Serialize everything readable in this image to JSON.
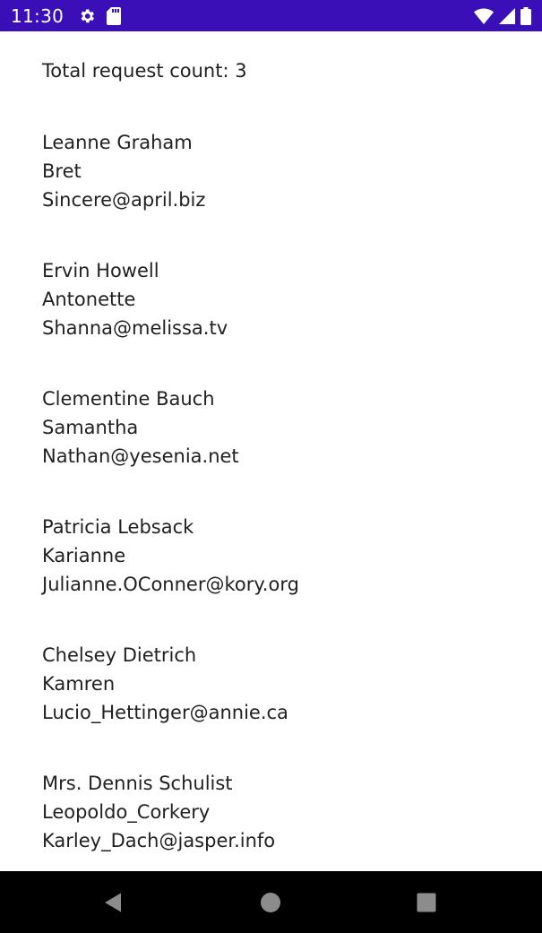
{
  "status_bar": {
    "time": "11:30",
    "left_icons": [
      "settings-gear-icon",
      "sd-card-icon"
    ],
    "right_icons": [
      "wifi-icon",
      "cellular-signal-icon",
      "battery-icon"
    ],
    "background_color": "#3a0fb8"
  },
  "main": {
    "request_count_text": "Total request count: 3",
    "users": [
      {
        "name": "Leanne Graham",
        "username": "Bret",
        "email": "Sincere@april.biz"
      },
      {
        "name": "Ervin Howell",
        "username": "Antonette",
        "email": "Shanna@melissa.tv"
      },
      {
        "name": "Clementine Bauch",
        "username": "Samantha",
        "email": "Nathan@yesenia.net"
      },
      {
        "name": "Patricia Lebsack",
        "username": "Karianne",
        "email": "Julianne.OConner@kory.org"
      },
      {
        "name": "Chelsey Dietrich",
        "username": "Kamren",
        "email": "Lucio_Hettinger@annie.ca"
      },
      {
        "name": "Mrs. Dennis Schulist",
        "username": "Leopoldo_Corkery",
        "email": "Karley_Dach@jasper.info"
      }
    ]
  },
  "nav_bar": {
    "buttons": [
      "back-icon",
      "home-icon",
      "recents-icon"
    ]
  }
}
